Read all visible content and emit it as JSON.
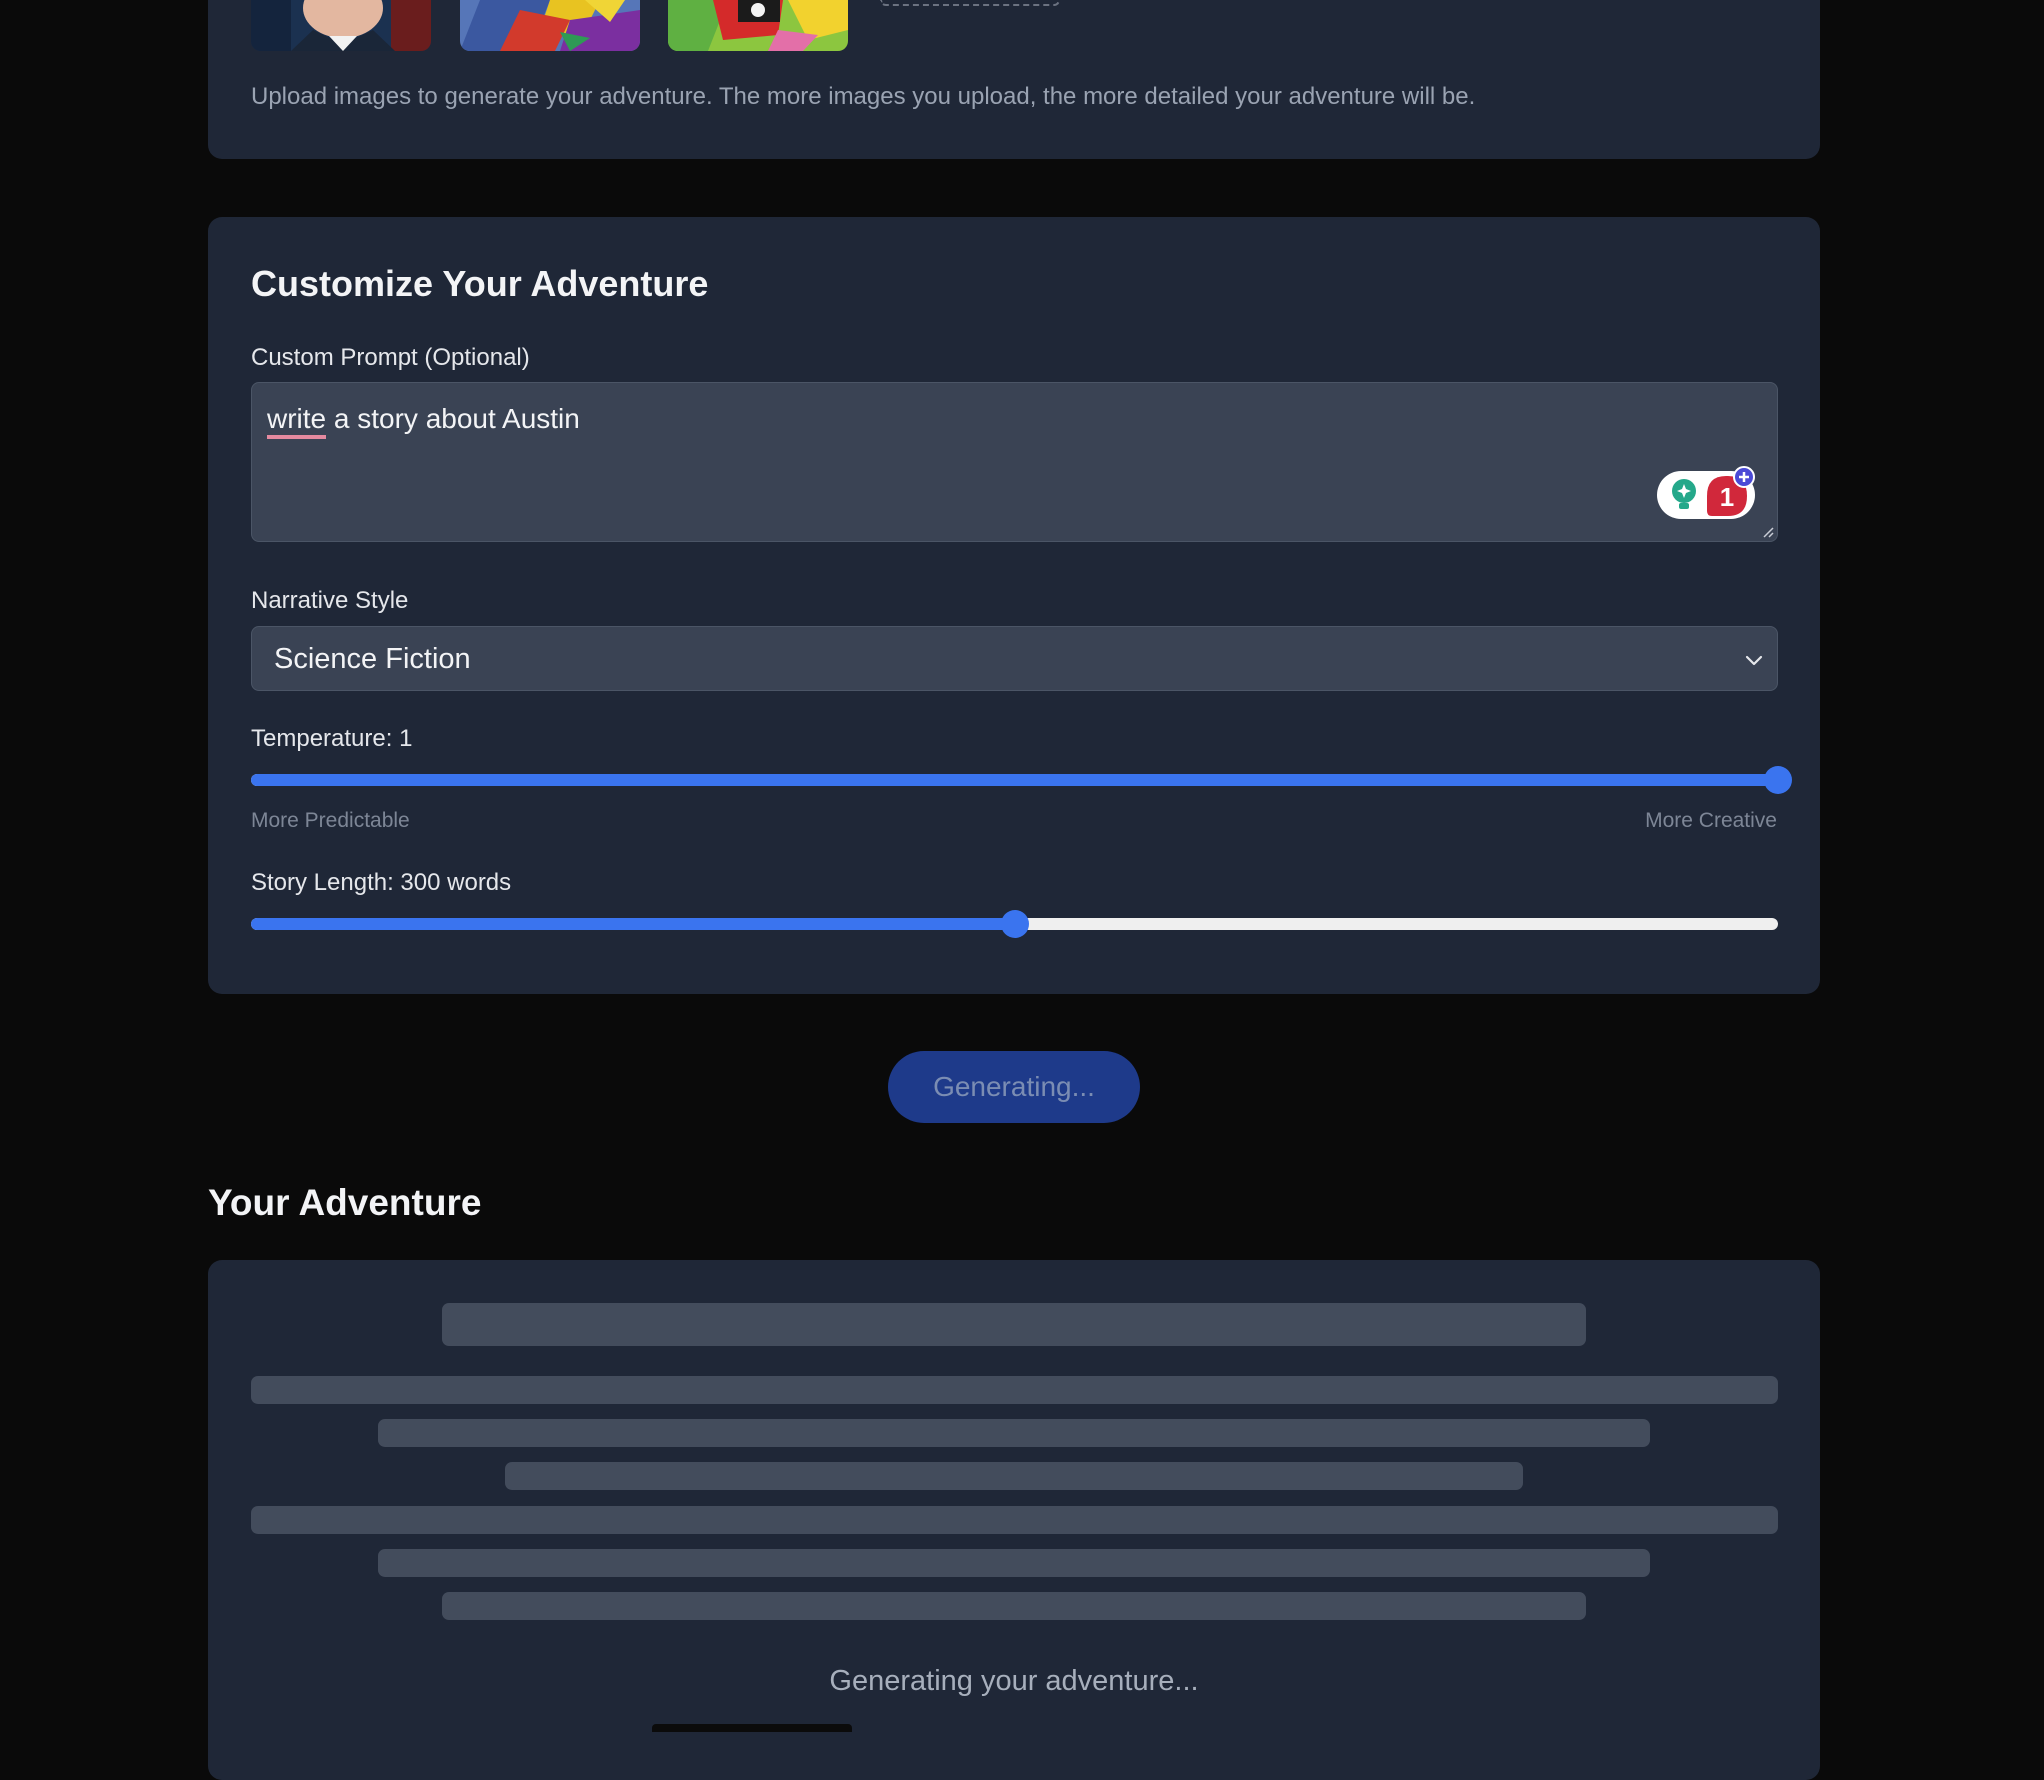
{
  "upload": {
    "help_text": "Upload images to generate your adventure. The more images you upload, the more detailed your adventure will be."
  },
  "customize": {
    "title": "Customize Your Adventure",
    "prompt_label": "Custom Prompt (Optional)",
    "prompt_value": {
      "first_word": "write",
      "rest": " a story about Austin"
    },
    "extension_badge_count": "1",
    "style_label": "Narrative Style",
    "style_value": "Science Fiction",
    "temperature": {
      "label": "Temperature: 1",
      "value": 1,
      "min": 0,
      "max": 1,
      "min_caption": "More Predictable",
      "max_caption": "More Creative"
    },
    "length": {
      "label": "Story Length: 300 words",
      "value": 300,
      "fill_fraction": 0.5
    }
  },
  "generate_button": "Generating...",
  "adventure": {
    "heading": "Your Adventure",
    "loading_text": "Generating your adventure..."
  },
  "colors": {
    "page_bg": "#0a0a0a",
    "card_bg": "#1f2737",
    "accent": "#3a74ef",
    "button_bg": "#1e3a8a"
  },
  "icons": [
    "lightbulb-icon",
    "notification-badge",
    "plus-icon",
    "chevron-down-icon",
    "resize-handle-icon"
  ]
}
